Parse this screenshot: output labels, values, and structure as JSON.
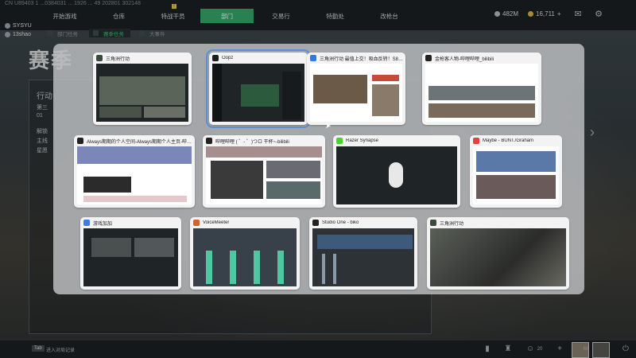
{
  "game": {
    "uid": "CN U89403 1 ...0384031 ... 1926 ... 49 202801 302148",
    "tabs": [
      {
        "label": "开始游戏",
        "active": false
      },
      {
        "label": "仓库",
        "active": false
      },
      {
        "label": "特战干员",
        "active": false,
        "badge": "!"
      },
      {
        "label": "部门",
        "active": true
      },
      {
        "label": "交易行",
        "active": false
      },
      {
        "label": "特勤处",
        "active": false
      },
      {
        "label": "改枪台",
        "active": false
      }
    ],
    "players": [
      "SYSYU",
      "13shao"
    ],
    "currency_a": "482M",
    "currency_b": "16,711",
    "currency_plus": "+",
    "subtabs": [
      {
        "label": "部门任务",
        "active": false
      },
      {
        "label": "赛季任务",
        "active": true
      },
      {
        "label": "大事件",
        "active": false
      }
    ],
    "page_title": "赛季",
    "panel_lines": [
      "行动",
      "第三",
      "01",
      "解锁",
      "主线",
      "星愿"
    ],
    "bottom_key": "Tab",
    "bottom_hint": "进入对局记录",
    "bottom_count_a": "20",
    "bottom_count_b": "60"
  },
  "switcher": {
    "windows": [
      {
        "title": "三角洲行动",
        "icon_color": "#3a4a3f",
        "theme": "dark",
        "selected": false
      },
      {
        "title": "Oopz",
        "icon_color": "#1b1e20",
        "theme": "dark",
        "selected": true
      },
      {
        "title": "三角洲行动 最值上交！吸血反转！S8赛季任务优…",
        "icon_color": "#2e7dd8",
        "theme": "light",
        "selected": false
      },
      {
        "title": "金枪客人物-哔哩哔哩_bilibili",
        "icon_color": "#222222",
        "theme": "light",
        "selected": false
      },
      {
        "title": "Always期期的个人空间-Always期期个人主页-哔哩…",
        "icon_color": "#222222",
        "theme": "light",
        "selected": false
      },
      {
        "title": "哔哩哔哩 ( ゜- ゜)つロ 干杯~-bilibili",
        "icon_color": "#222222",
        "theme": "light",
        "selected": false
      },
      {
        "title": "Razer Synapse",
        "icon_color": "#44d62c",
        "theme": "dark",
        "selected": false
      },
      {
        "title": "Maybe - BUNT./Graham",
        "icon_color": "#e0433f",
        "theme": "light",
        "selected": false
      },
      {
        "title": "游戏加加",
        "icon_color": "#3a7de0",
        "theme": "dark",
        "selected": false
      },
      {
        "title": "VoiceMeeter",
        "icon_color": "#d8602b",
        "theme": "dark",
        "selected": false
      },
      {
        "title": "Studio One - biko",
        "icon_color": "#222222",
        "theme": "dark",
        "selected": false
      },
      {
        "title": "三角洲行动",
        "icon_color": "#3a4a3f",
        "theme": "dark",
        "selected": false
      }
    ]
  }
}
